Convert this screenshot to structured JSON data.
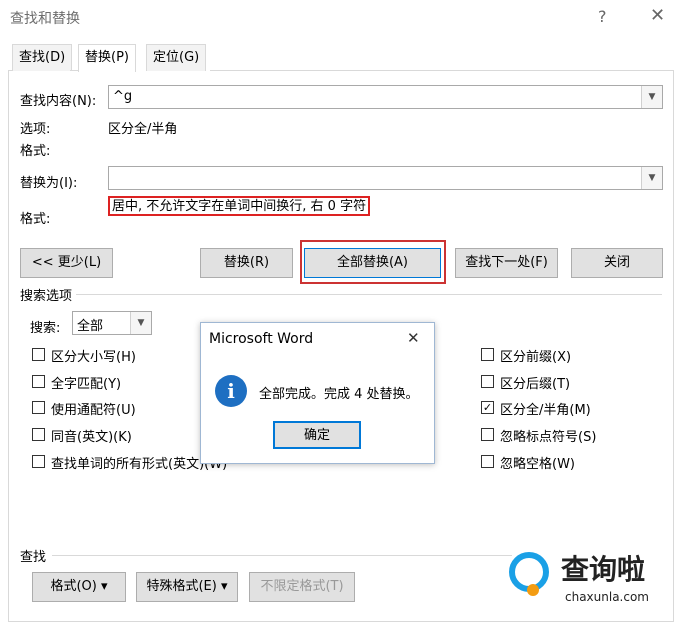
{
  "window": {
    "title": "查找和替换",
    "help_glyph": "?",
    "close_glyph": "✕"
  },
  "tabs": [
    {
      "label": "查找(D)",
      "active": false
    },
    {
      "label": "替换(P)",
      "active": true
    },
    {
      "label": "定位(G)",
      "active": false
    }
  ],
  "find": {
    "label": "查找内容(N):",
    "value": "^g"
  },
  "options": {
    "label": "选项:",
    "value": "区分全/半角"
  },
  "format1": {
    "label": "格式:"
  },
  "replace": {
    "label": "替换为(I):",
    "value": ""
  },
  "format2": {
    "label": "格式:",
    "value": "居中, 不允许文字在单词中间换行, 右  0 字符"
  },
  "buttons": {
    "less": "<< 更少(L)",
    "replace": "替换(R)",
    "replace_all": "全部替换(A)",
    "find_next": "查找下一处(F)",
    "close": "关闭"
  },
  "search_options": {
    "header": "搜索选项",
    "search_label": "搜索:",
    "search_value": "全部",
    "left": [
      {
        "label": "区分大小写(H)",
        "checked": false
      },
      {
        "label": "全字匹配(Y)",
        "checked": false
      },
      {
        "label": "使用通配符(U)",
        "checked": false
      },
      {
        "label": "同音(英文)(K)",
        "checked": false
      },
      {
        "label": "查找单词的所有形式(英文)(W)",
        "checked": false
      }
    ],
    "right": [
      {
        "label": "区分前缀(X)",
        "checked": false
      },
      {
        "label": "区分后缀(T)",
        "checked": false
      },
      {
        "label": "区分全/半角(M)",
        "checked": true
      },
      {
        "label": "忽略标点符号(S)",
        "checked": false
      },
      {
        "label": "忽略空格(W)",
        "checked": false
      }
    ]
  },
  "find_section": {
    "header": "查找",
    "format_btn": "格式(O)",
    "special_btn": "特殊格式(E)",
    "noformat_btn": "不限定格式(T)"
  },
  "msgbox": {
    "title": "Microsoft Word",
    "close_glyph": "✕",
    "icon": "information-icon",
    "icon_glyph": "i",
    "message": "全部完成。完成 4 处替换。",
    "ok": "确定"
  },
  "watermark": {
    "brand": "查询啦",
    "domain": "chaxunla.com"
  },
  "colors": {
    "accent": "#0078d7",
    "highlight_red": "#d22222",
    "info_blue": "#1e6fc2",
    "logo_blue": "#1aa0e6",
    "logo_orange": "#f39c12"
  }
}
